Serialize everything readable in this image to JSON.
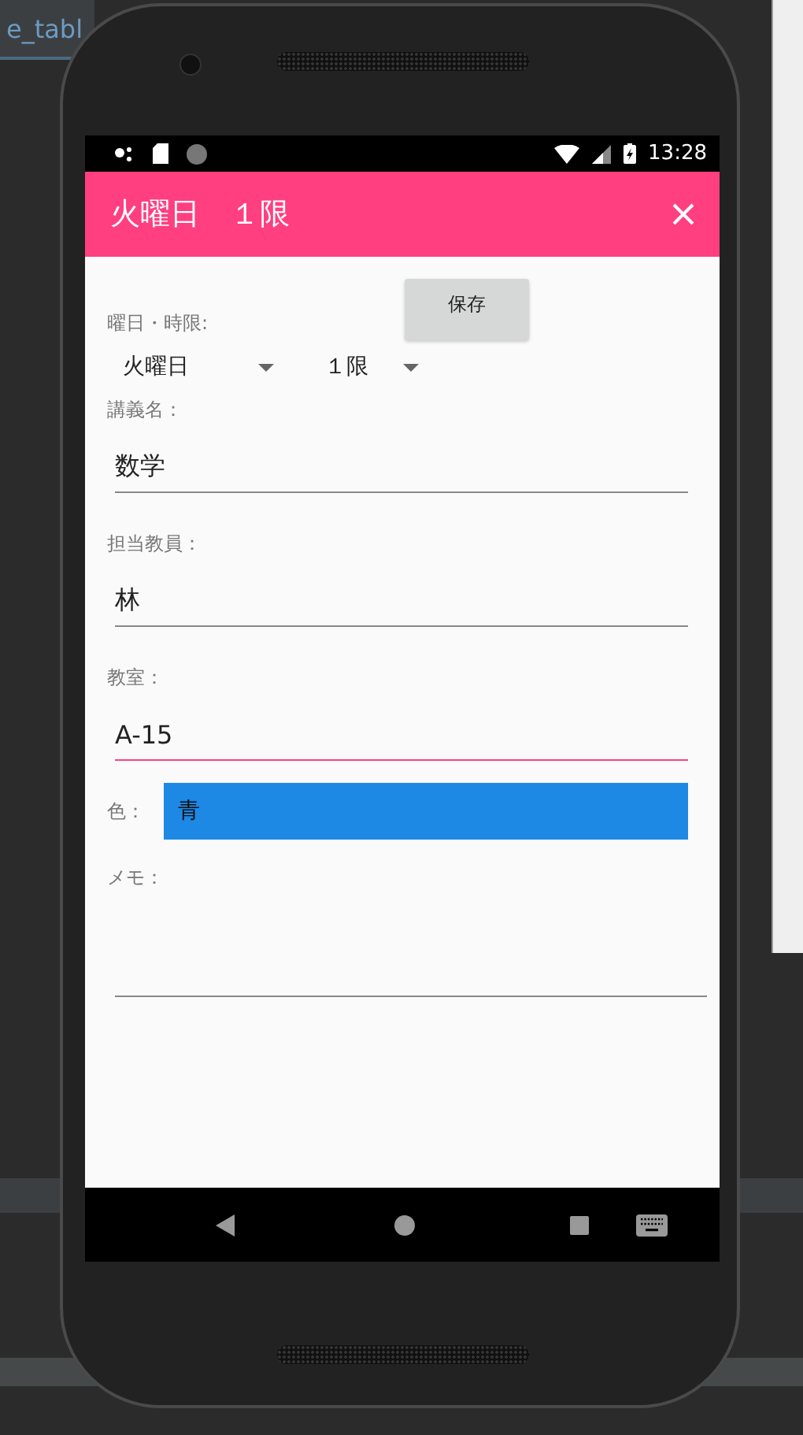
{
  "ide": {
    "tab_label": "e_tabl"
  },
  "status_bar": {
    "time": "13:28"
  },
  "toolbar": {
    "title": "火曜日　１限"
  },
  "form": {
    "day_period_label": "曜日・時限:",
    "save_button": "保存",
    "spinners": [
      {
        "value": "火曜日"
      },
      {
        "value": "１限"
      }
    ],
    "fields": [
      {
        "label": "講義名：",
        "value": "数学",
        "focused": false
      },
      {
        "label": "担当教員：",
        "value": "林",
        "focused": false
      },
      {
        "label": "教室：",
        "value": "A-15",
        "focused": true
      }
    ],
    "color_picker": {
      "label": "色：",
      "value": "青",
      "color": "#1e88e5"
    },
    "memo": {
      "label": "メモ："
    }
  }
}
